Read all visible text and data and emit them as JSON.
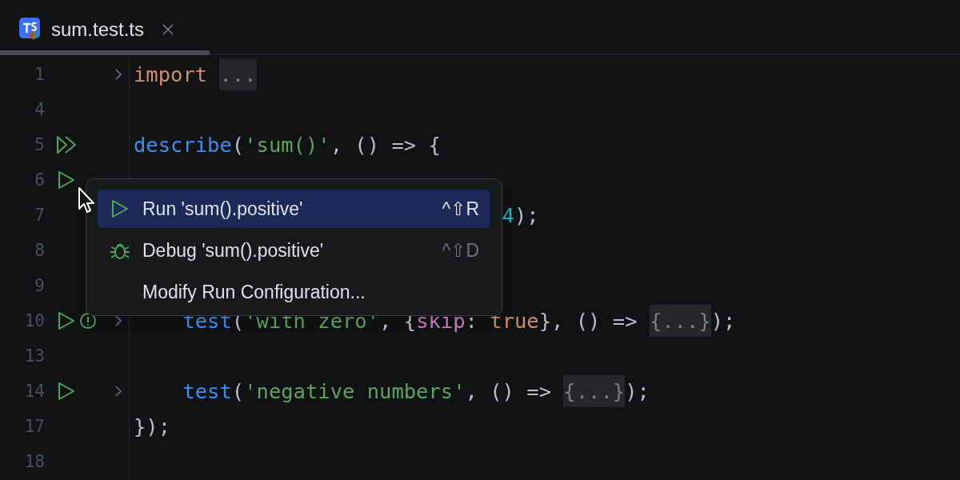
{
  "tab": {
    "title": "sum.test.ts",
    "selected": true
  },
  "lines": [
    {
      "number": "1",
      "fold": true,
      "tokens": [
        {
          "kind": "kw",
          "text": "import "
        },
        {
          "kind": "fold",
          "text": "..."
        }
      ]
    },
    {
      "number": "4",
      "fold": false
    },
    {
      "number": "5",
      "gutter": [
        {
          "kind": "run_all"
        }
      ],
      "fold": false,
      "tokens": [
        {
          "kind": "fn",
          "text": "describe"
        },
        {
          "kind": "punct",
          "text": "("
        },
        {
          "kind": "str",
          "text": "'sum()'"
        },
        {
          "kind": "punct",
          "text": ", () => {"
        }
      ]
    },
    {
      "number": "6",
      "gutter": [
        {
          "kind": "run"
        }
      ],
      "fold": false
    },
    {
      "number": "7",
      "kind": "cut",
      "fold": false,
      "tokens": [
        {
          "kind": "num",
          "text": "4"
        },
        {
          "kind": "punct",
          "text": ");"
        }
      ]
    },
    {
      "number": "8",
      "fold": false
    },
    {
      "number": "9",
      "fold": false
    },
    {
      "number": "10",
      "kind": "nested",
      "gutter": [
        {
          "kind": "run"
        },
        {
          "kind": "skipped"
        }
      ],
      "fold": true,
      "tokens": [
        {
          "kind": "fn",
          "text": "test"
        },
        {
          "kind": "punct",
          "text": "("
        },
        {
          "kind": "str",
          "text": "'with zero'"
        },
        {
          "kind": "punct",
          "text": ", {"
        },
        {
          "kind": "prop",
          "text": "skip"
        },
        {
          "kind": "punct",
          "text": ": "
        },
        {
          "kind": "kw",
          "text": "true"
        },
        {
          "kind": "punct",
          "text": "}, () => "
        },
        {
          "kind": "fold",
          "text": "{...}"
        },
        {
          "kind": "punct",
          "text": ");"
        }
      ]
    },
    {
      "number": "13",
      "fold": false
    },
    {
      "number": "14",
      "kind": "nested",
      "gutter": [
        {
          "kind": "run"
        }
      ],
      "fold": true,
      "tokens": [
        {
          "kind": "fn",
          "text": "test"
        },
        {
          "kind": "punct",
          "text": "("
        },
        {
          "kind": "str",
          "text": "'negative numbers'"
        },
        {
          "kind": "punct",
          "text": ", () => "
        },
        {
          "kind": "fold",
          "text": "{...}"
        },
        {
          "kind": "punct",
          "text": ");"
        }
      ]
    },
    {
      "number": "17",
      "fold": false,
      "tokens": [
        {
          "kind": "punct",
          "text": "});"
        }
      ]
    },
    {
      "number": "18",
      "fold": false
    }
  ],
  "popup": {
    "items": [
      {
        "kind": "run",
        "label": "Run 'sum().positive'",
        "shortcut": "^⇧R",
        "selected": true
      },
      {
        "kind": "debug",
        "label": "Debug 'sum().positive'",
        "shortcut": "^⇧D",
        "selected": false
      },
      {
        "kind": "plain",
        "label": "Modify Run Configuration...",
        "selected": false
      }
    ]
  }
}
